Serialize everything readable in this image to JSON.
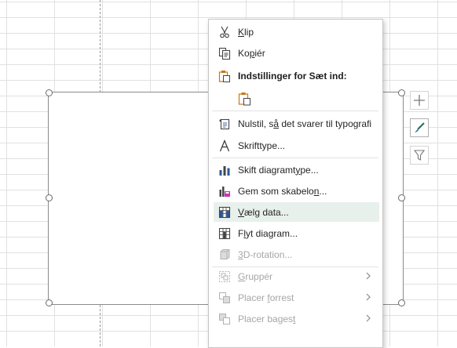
{
  "menu": {
    "items": [
      {
        "id": "klip",
        "pre": "",
        "acc": "K",
        "post": "lip",
        "icon": "scissors-icon"
      },
      {
        "id": "kopier",
        "pre": "Ko",
        "acc": "p",
        "post": "iér",
        "icon": "copy-icon"
      },
      {
        "id": "paste-options",
        "pre": "Indstillinger for Sæt ind:",
        "acc": "",
        "post": "",
        "icon": "paste-icon"
      },
      {
        "id": "reset",
        "pre": "Nulstil, s",
        "acc": "å",
        "post": " det svarer til typografi",
        "icon": "reset-style-icon"
      },
      {
        "id": "font",
        "pre": "Skrifttype",
        "acc": "",
        "post": "...",
        "icon": "font-icon"
      },
      {
        "id": "change-chart-type",
        "pre": "Skift diagramt",
        "acc": "y",
        "post": "pe...",
        "icon": "chart-type-icon"
      },
      {
        "id": "save-template",
        "pre": "Gem som skabelo",
        "acc": "n",
        "post": "...",
        "icon": "save-template-icon"
      },
      {
        "id": "select-data",
        "pre": "",
        "acc": "V",
        "post": "ælg data...",
        "icon": "select-data-icon"
      },
      {
        "id": "move-chart",
        "pre": "F",
        "acc": "l",
        "post": "yt diagram...",
        "icon": "move-chart-icon"
      },
      {
        "id": "3d-rotation",
        "pre": "",
        "acc": "3",
        "post": "D-rotation...",
        "icon": "3d-rotation-icon"
      },
      {
        "id": "group",
        "pre": "",
        "acc": "G",
        "post": "ruppér",
        "icon": "group-icon"
      },
      {
        "id": "bring-forward",
        "pre": "Placer ",
        "acc": "f",
        "post": "orrest",
        "icon": "bring-forward-icon"
      },
      {
        "id": "send-backward",
        "pre": "Placer bages",
        "acc": "t",
        "post": "",
        "icon": "send-backward-icon"
      }
    ]
  },
  "colors": {
    "hover": "#e8f0ec",
    "accent_green": "#217346",
    "paste_orange": "#c47a12",
    "chart_blue": "#2b579a"
  }
}
